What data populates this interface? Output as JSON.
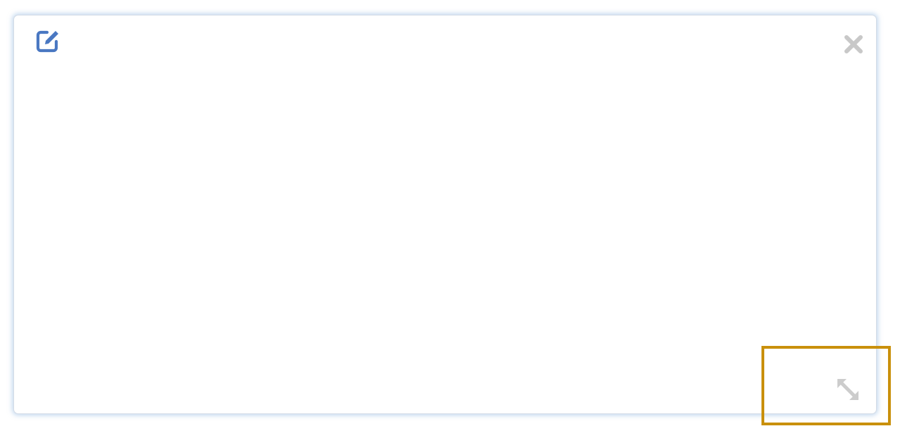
{
  "panel": {
    "body_text": "",
    "icons": {
      "edit": "edit-note-icon",
      "close": "close-icon",
      "resize": "resize-diagonal-icon"
    },
    "colors": {
      "edit_icon": "#4a78c2",
      "close_icon": "#c8c8c8",
      "resize_icon": "#cccccc",
      "panel_border": "#d3dbe6",
      "highlight": "#c9900c"
    }
  }
}
